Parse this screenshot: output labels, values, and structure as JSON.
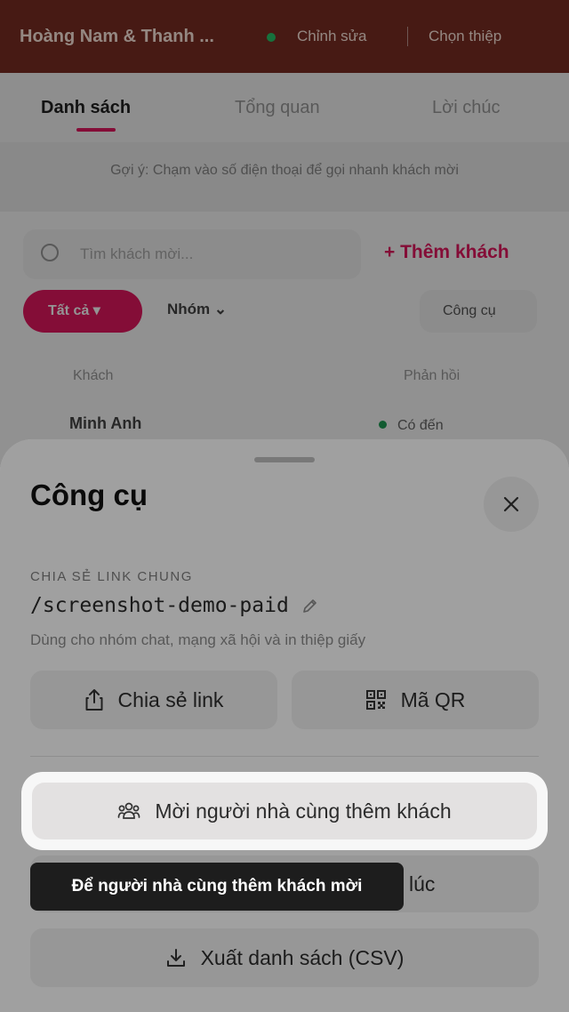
{
  "background": {
    "topbar": {
      "title": "Hoàng Nam & Thanh ...",
      "edit_label": "Chỉnh sửa",
      "switch_label": "Chọn thiệp"
    },
    "tabs": [
      "Danh sách",
      "Tổng quan",
      "Lời chúc"
    ],
    "hint": "Gợi ý: Chạm vào số điện thoại để gọi nhanh khách mời",
    "search_placeholder": "Tìm khách mời...",
    "add_guest_label": "+ Thêm khách",
    "filter_all": "Tất cả  ▾",
    "filter_group": "Nhóm  ⌄",
    "tools_label": "Công cụ",
    "col_guest": "Khách",
    "col_response": "Phản hồi",
    "guest_name": "Minh Anh",
    "guest_status": "Có đến"
  },
  "sheet": {
    "title": "Công cụ",
    "section_label": "CHIA SẺ LINK CHUNG",
    "link_path": "/screenshot-demo-paid",
    "description": "Dùng cho nhóm chat, mạng xã hội và in thiệp giấy",
    "share_label": "Chia sẻ link",
    "qr_label": "Mã QR",
    "invite_label": "Mời người nhà cùng thêm khách",
    "partial_label": "lúc",
    "export_label": "Xuất danh sách (CSV)"
  },
  "tooltip": {
    "text": "Để người nhà cùng thêm khách mời"
  },
  "icons": {
    "close": "close-icon",
    "edit": "pencil-icon",
    "share": "share-icon",
    "qr": "qr-code-icon",
    "invite": "people-group-icon",
    "export": "download-icon"
  },
  "colors": {
    "brand": "#e4175f",
    "topbar": "#7a2e23",
    "tooltip_bg": "#1d1d1d"
  }
}
